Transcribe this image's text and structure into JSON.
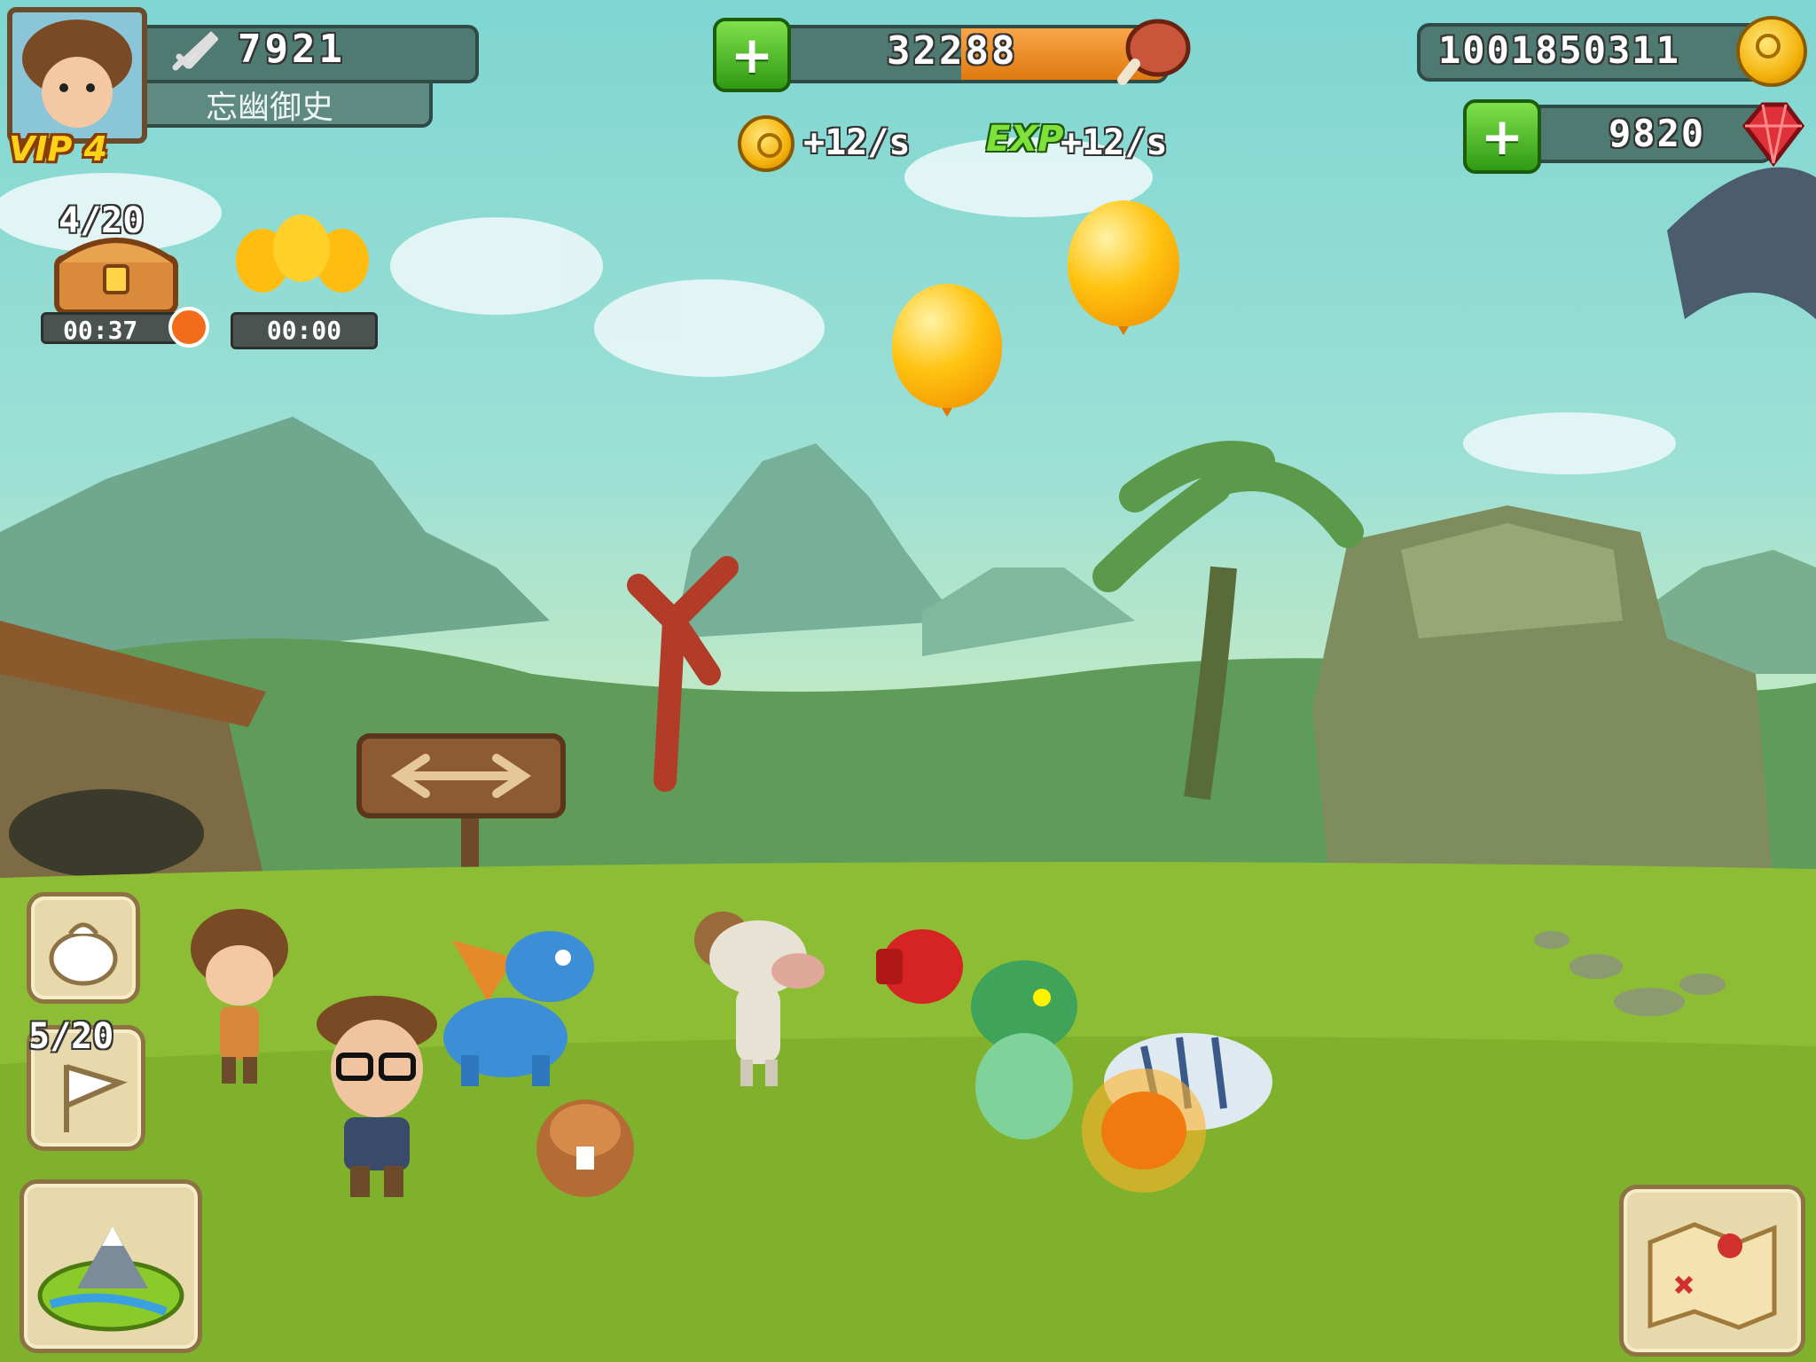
{
  "player": {
    "name": "忘幽御史",
    "vip_label": "VIP 4",
    "power": "7921"
  },
  "resources": {
    "meat": "32288",
    "gold": "1001850311",
    "gems": "9820",
    "gold_rate": "+12/s",
    "exp_label": "EXP",
    "exp_rate": "+12/s"
  },
  "rewards": {
    "chest_count": "4/20",
    "chest_timer": "00:37",
    "balloon_timer": "00:00"
  },
  "side": {
    "flag_count": "5/20"
  },
  "colors": {
    "sky": "#7fd6d3",
    "grass": "#8fbf3a",
    "bar_bg": "#4e7a72",
    "plus_green": "#3fb01f",
    "gold": "#f4b40d"
  },
  "icons": {
    "power": "sword-icon",
    "meat": "meat-icon",
    "gold": "gold-coin-icon",
    "gem": "ruby-gem-icon",
    "exp": "exp-icon",
    "chest": "treasure-chest-icon",
    "alarm": "alarm-clock-icon",
    "bag": "sack-icon",
    "flag": "flag-icon",
    "island": "island-mountain-icon",
    "map": "treasure-map-icon"
  }
}
